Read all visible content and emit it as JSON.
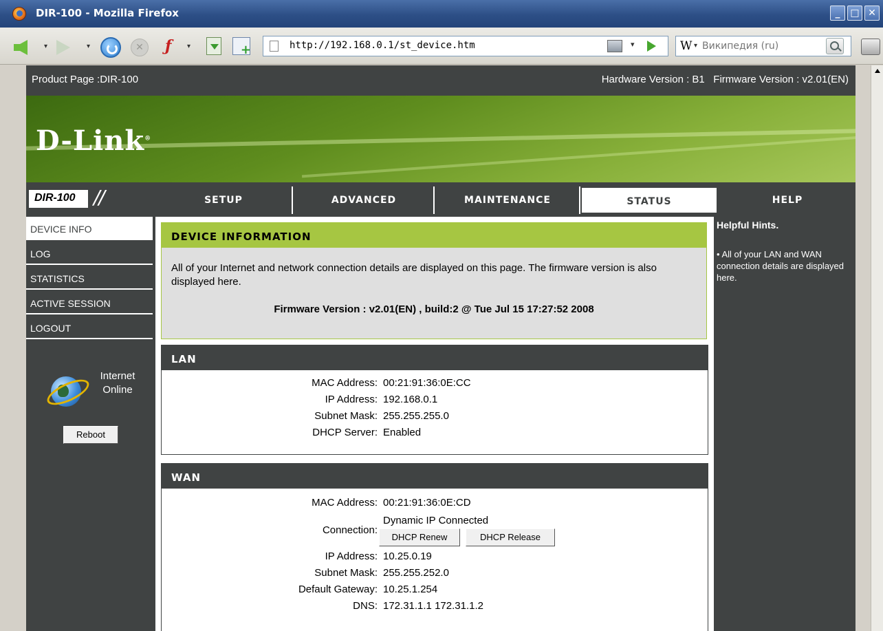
{
  "window": {
    "title": "DIR-100 - Mozilla Firefox"
  },
  "browser": {
    "url": "http://192.168.0.1/st_device.htm",
    "search_placeholder": "Википедия (ru)",
    "search_engine_icon": "W"
  },
  "page": {
    "product": "Product Page :DIR-100",
    "versions": "Hardware Version : B1   Firmware Version : v2.01(EN)",
    "logo": "D-Link",
    "logo_mark": "®",
    "model": "DIR-100",
    "slashes": "//"
  },
  "nav": {
    "tabs": [
      {
        "label": "SETUP"
      },
      {
        "label": "ADVANCED"
      },
      {
        "label": "MAINTENANCE"
      },
      {
        "label": "STATUS"
      },
      {
        "label": "HELP"
      }
    ]
  },
  "sidebar": {
    "items": [
      {
        "label": "DEVICE INFO"
      },
      {
        "label": "LOG"
      },
      {
        "label": "STATISTICS"
      },
      {
        "label": "ACTIVE SESSION"
      },
      {
        "label": "LOGOUT"
      }
    ],
    "status_line1": "Internet",
    "status_line2": "Online",
    "reboot": "Reboot"
  },
  "device_info": {
    "title": "DEVICE INFORMATION",
    "description": "All of your Internet and network connection details are displayed on this page. The firmware version is also displayed here.",
    "firmware": "Firmware Version : v2.01(EN) , build:2 @ Tue Jul 15 17:27:52 2008"
  },
  "lan": {
    "title": "LAN",
    "rows": [
      {
        "label": "MAC Address:",
        "value": "00:21:91:36:0E:CC"
      },
      {
        "label": "IP Address:",
        "value": "192.168.0.1"
      },
      {
        "label": "Subnet Mask:",
        "value": "255.255.255.0"
      },
      {
        "label": "DHCP Server:",
        "value": "Enabled"
      }
    ]
  },
  "wan": {
    "title": "WAN",
    "mac_label": "MAC Address:",
    "mac": "00:21:91:36:0E:CD",
    "conn_label": "Connection:",
    "conn": "Dynamic IP Connected",
    "renew": "DHCP Renew",
    "release": "DHCP Release",
    "ip_label": "IP Address:",
    "ip": "10.25.0.19",
    "mask_label": "Subnet Mask:",
    "mask": "255.255.252.0",
    "gw_label": "Default Gateway:",
    "gw": "10.25.1.254",
    "dns_label": "DNS:",
    "dns": "172.31.1.1 172.31.1.2"
  },
  "hints": {
    "title": "Helpful Hints.",
    "text": "• All of your LAN and WAN connection details are displayed here."
  }
}
